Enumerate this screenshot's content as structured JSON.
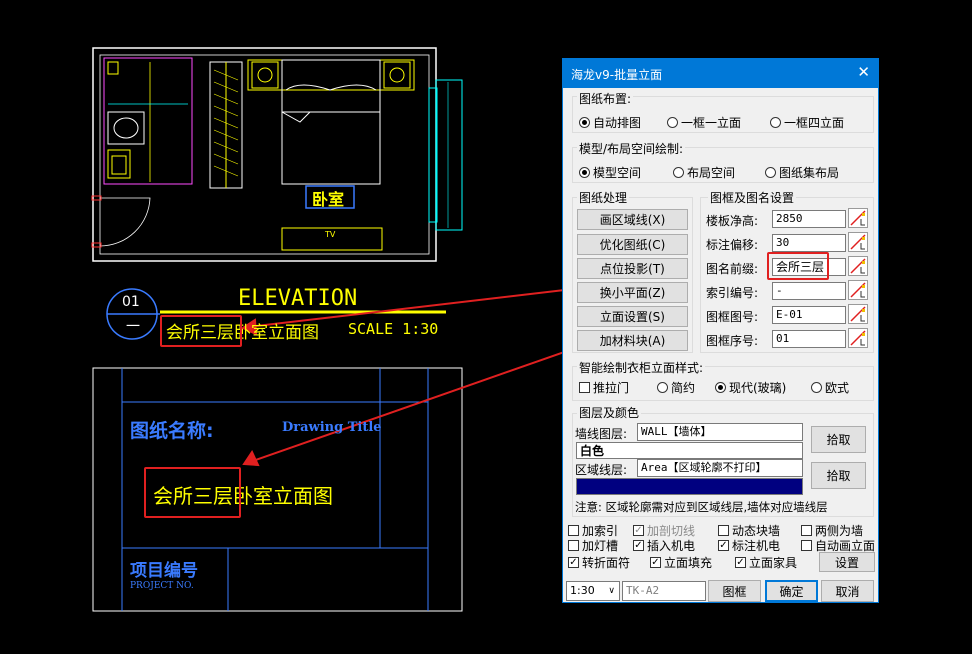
{
  "drawing": {
    "room_label": "卧室",
    "tv_label": "TV",
    "callout_num": "01",
    "callout_sub": "一",
    "elevation_title": "ELEVATION",
    "elevation_name": "会所三层卧室立面图",
    "scale_text": "SCALE 1:30",
    "titleblock_label": "图纸名称:",
    "titleblock_label_en": "Drawing Title",
    "titleblock_value": "会所三层卧室立面图",
    "project_label": "项目编号",
    "project_label_en": "PROJECT NO."
  },
  "dialog": {
    "title": "海龙v9-批量立面",
    "layout_group": "图纸布置:",
    "layout_options": [
      "自动排图",
      "一框一立面",
      "一框四立面"
    ],
    "space_group": "模型/布局空间绘制:",
    "space_options": [
      "模型空间",
      "布局空间",
      "图纸集布局"
    ],
    "process_group": "图纸处理",
    "process_buttons": [
      "画区域线(X)",
      "优化图纸(C)",
      "点位投影(T)",
      "换小平面(Z)",
      "立面设置(S)",
      "加材料块(A)"
    ],
    "frame_group": "图框及图名设置",
    "fields": [
      {
        "label": "楼板净高:",
        "value": "2850"
      },
      {
        "label": "标注偏移:",
        "value": "30"
      },
      {
        "label": "图名前缀:",
        "value": "会所三层"
      },
      {
        "label": "索引编号:",
        "value": "-"
      },
      {
        "label": "图框图号:",
        "value": "E-01"
      },
      {
        "label": "图框序号:",
        "value": "01"
      }
    ],
    "wardrobe_group": "智能绘制衣柜立面样式:",
    "wardrobe_options": [
      "推拉门",
      "简约",
      "现代(玻璃)",
      "欧式"
    ],
    "layer_group": "图层及颜色",
    "wall_layer_label": "墙线图层:",
    "wall_layer_value": "WALL【墙体】",
    "wall_color": "白色",
    "area_layer_label": "区域线层:",
    "area_layer_value": "Area【区域轮廓不打印】",
    "area_color": "蓝色",
    "pick_button": "拾取",
    "note": "注意: 区域轮廓需对应到区域线层,墙体对应墙线层",
    "checkboxes": [
      {
        "label": "加索引",
        "checked": false,
        "disabled": false
      },
      {
        "label": "加剖切线",
        "checked": true,
        "disabled": true
      },
      {
        "label": "动态块墙",
        "checked": false,
        "disabled": false
      },
      {
        "label": "两侧为墙",
        "checked": false,
        "disabled": false
      },
      {
        "label": "加灯槽",
        "checked": false,
        "disabled": false
      },
      {
        "label": "插入机电",
        "checked": true,
        "disabled": false
      },
      {
        "label": "标注机电",
        "checked": true,
        "disabled": false
      },
      {
        "label": "自动画立面",
        "checked": false,
        "disabled": false
      },
      {
        "label": "转折面符",
        "checked": true,
        "disabled": false
      },
      {
        "label": "立面填充",
        "checked": true,
        "disabled": false
      },
      {
        "label": "立面家具",
        "checked": true,
        "disabled": false
      }
    ],
    "settings_button": "设置",
    "scale_value": "1:30",
    "frame_value": "TK-A2",
    "frame_button": "图框",
    "ok_button": "确定",
    "cancel_button": "取消",
    "colors": {
      "accent": "#0078d7",
      "highlight": "#e02020",
      "cad_yellow": "#ffff00",
      "cad_blue": "#3a7bff"
    }
  }
}
